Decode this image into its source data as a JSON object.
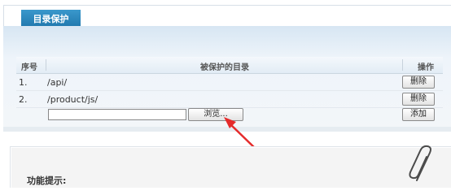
{
  "tab": {
    "label": "目录保护"
  },
  "table": {
    "headers": {
      "index": "序号",
      "dir": "被保护的目录",
      "op": "操作"
    },
    "rows": [
      {
        "index": "1.",
        "path": "/api/",
        "action": "删除"
      },
      {
        "index": "2.",
        "path": "/product/js/",
        "action": "删除"
      }
    ],
    "input": {
      "value": "",
      "placeholder": ""
    },
    "browse_label": "浏览...",
    "add_label": "添加"
  },
  "tips": {
    "title": "功能提示:"
  },
  "colors": {
    "tab_blue": "#1f76ab",
    "arrow_red": "#e52b2b"
  },
  "icons": [
    "paperclip-icon",
    "red-arrow-annotation"
  ]
}
